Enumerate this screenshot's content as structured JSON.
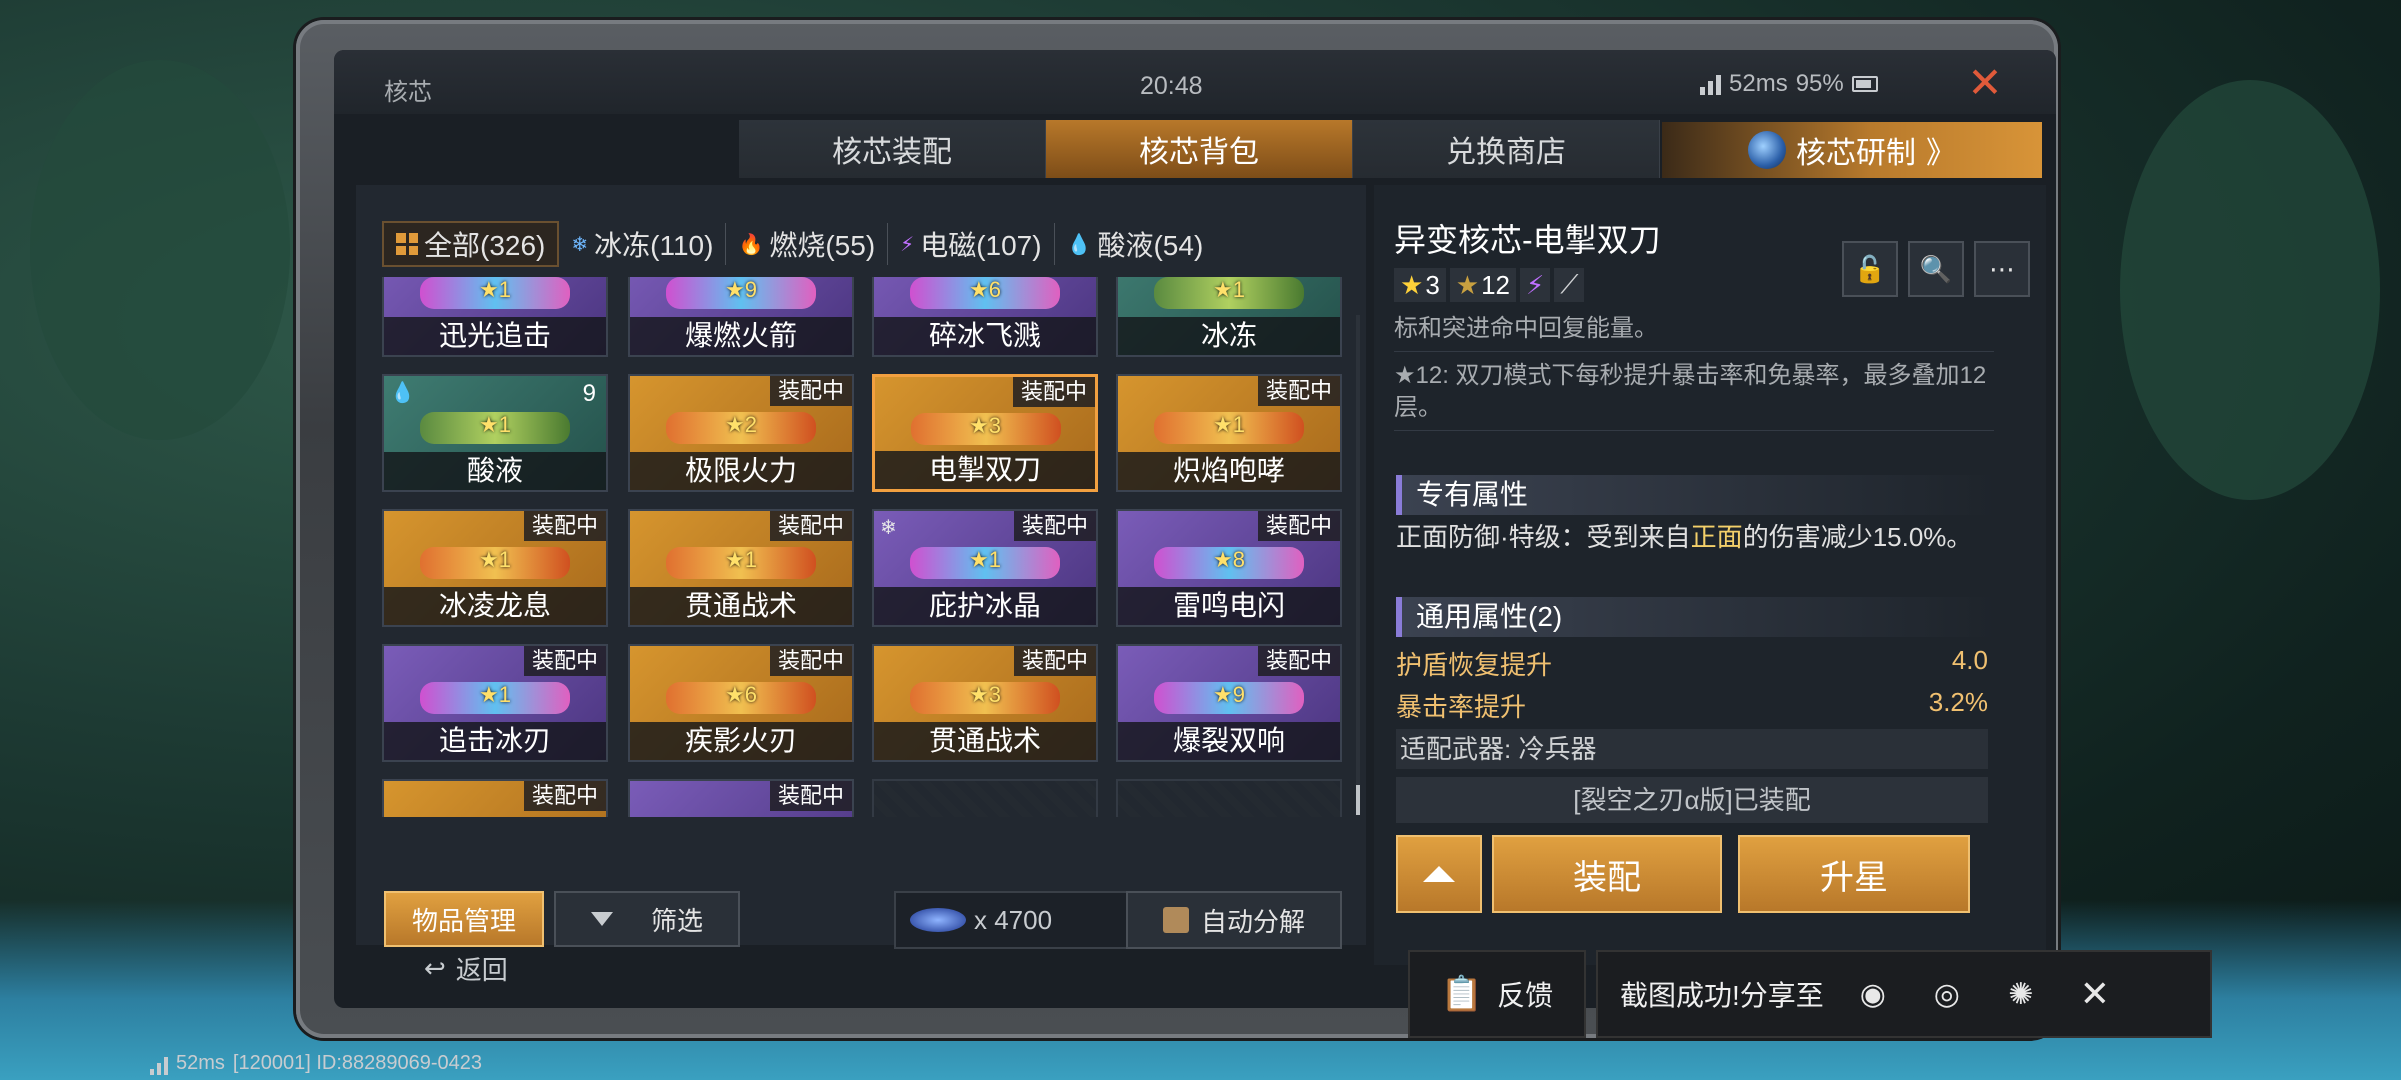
{
  "window": {
    "title": "核芯",
    "clock": "20:48",
    "ping": "52ms",
    "battery": "95%"
  },
  "tabs": [
    {
      "label": "核芯装配"
    },
    {
      "label": "核芯背包"
    },
    {
      "label": "兑换商店"
    }
  ],
  "active_tab": 1,
  "research_label": "核芯研制",
  "research_arrow": "》",
  "filters": [
    {
      "label": "全部(326)",
      "icon": "grid-icon"
    },
    {
      "label": "冰冻(110)",
      "icon": "snowflake-icon",
      "glyph": "❄",
      "color": "#6fb8ff"
    },
    {
      "label": "燃烧(55)",
      "icon": "flame-icon",
      "glyph": "🔥",
      "color": "#ff7a2a"
    },
    {
      "label": "电磁(107)",
      "icon": "lightning-icon",
      "glyph": "⚡",
      "color": "#c070ff"
    },
    {
      "label": "酸液(54)",
      "icon": "acid-drop-icon",
      "glyph": "💧",
      "color": "#8fd84a"
    }
  ],
  "cards": [
    {
      "name": "迅光追击",
      "style": "purple",
      "stars": "1"
    },
    {
      "name": "爆燃火箭",
      "style": "purple",
      "stars": "9"
    },
    {
      "name": "碎冰飞溅",
      "style": "purple",
      "stars": "6"
    },
    {
      "name": "冰冻",
      "style": "teal",
      "stars": "1"
    },
    {
      "name": "酸液",
      "style": "teal",
      "stars": "1",
      "count": "9",
      "elem": "💧"
    },
    {
      "name": "极限火力",
      "style": "gold",
      "stars": "2",
      "badge": "装配中"
    },
    {
      "name": "电掣双刀",
      "style": "gold",
      "stars": "3",
      "badge": "装配中",
      "selected": true
    },
    {
      "name": "炽焰咆哮",
      "style": "gold",
      "stars": "1",
      "badge": "装配中"
    },
    {
      "name": "冰凌龙息",
      "style": "gold",
      "stars": "1",
      "badge": "装配中"
    },
    {
      "name": "贯通战术",
      "style": "gold",
      "stars": "1",
      "badge": "装配中"
    },
    {
      "name": "庇护冰晶",
      "style": "purple",
      "stars": "1",
      "badge": "装配中",
      "elem": "❄"
    },
    {
      "name": "雷鸣电闪",
      "style": "purple",
      "stars": "8",
      "badge": "装配中"
    },
    {
      "name": "追击冰刃",
      "style": "purple",
      "stars": "1",
      "badge": "装配中"
    },
    {
      "name": "疾影火刃",
      "style": "gold",
      "stars": "6",
      "badge": "装配中"
    },
    {
      "name": "贯通战术",
      "style": "gold",
      "stars": "3",
      "badge": "装配中"
    },
    {
      "name": "爆裂双响",
      "style": "purple",
      "stars": "9",
      "badge": "装配中"
    },
    {
      "name": "",
      "style": "gold",
      "stars": "",
      "badge": "装配中"
    },
    {
      "name": "",
      "style": "purple",
      "stars": "",
      "badge": "装配中"
    },
    {
      "name": "",
      "style": "empty"
    },
    {
      "name": "",
      "style": "empty"
    }
  ],
  "left_actions": {
    "manage": "物品管理",
    "filter": "筛选",
    "currency": "x 4700",
    "decompose": "自动分解"
  },
  "detail": {
    "title": "异变核芯-电掣双刀",
    "star_a": "3",
    "star_b": "12",
    "desc_top": "标和突进命中回复能量。",
    "desc_12": "★12: 双刀模式下每秒提升暴击率和免暴率，最多叠加12层。",
    "section_exclusive": "专有属性",
    "exclusive_a": "正面防御·特级：受到来自",
    "exclusive_hl": "正面",
    "exclusive_b": "的伤害减少15.0%。",
    "section_general": "通用属性(2)",
    "props": [
      {
        "name": "护盾恢复提升",
        "value": "4.0"
      },
      {
        "name": "暴击率提升",
        "value": "3.2%"
      }
    ],
    "weapon": "适配武器: 冷兵器",
    "equipped": "[裂空之刃α版]已装配",
    "btn_equip": "装配",
    "btn_upstar": "升星"
  },
  "back_label": "返回",
  "feedback_label": "反馈",
  "share_label": "截图成功!分享至",
  "footer": {
    "ping": "52ms",
    "id": "[120001] ID:88289069-0423"
  }
}
